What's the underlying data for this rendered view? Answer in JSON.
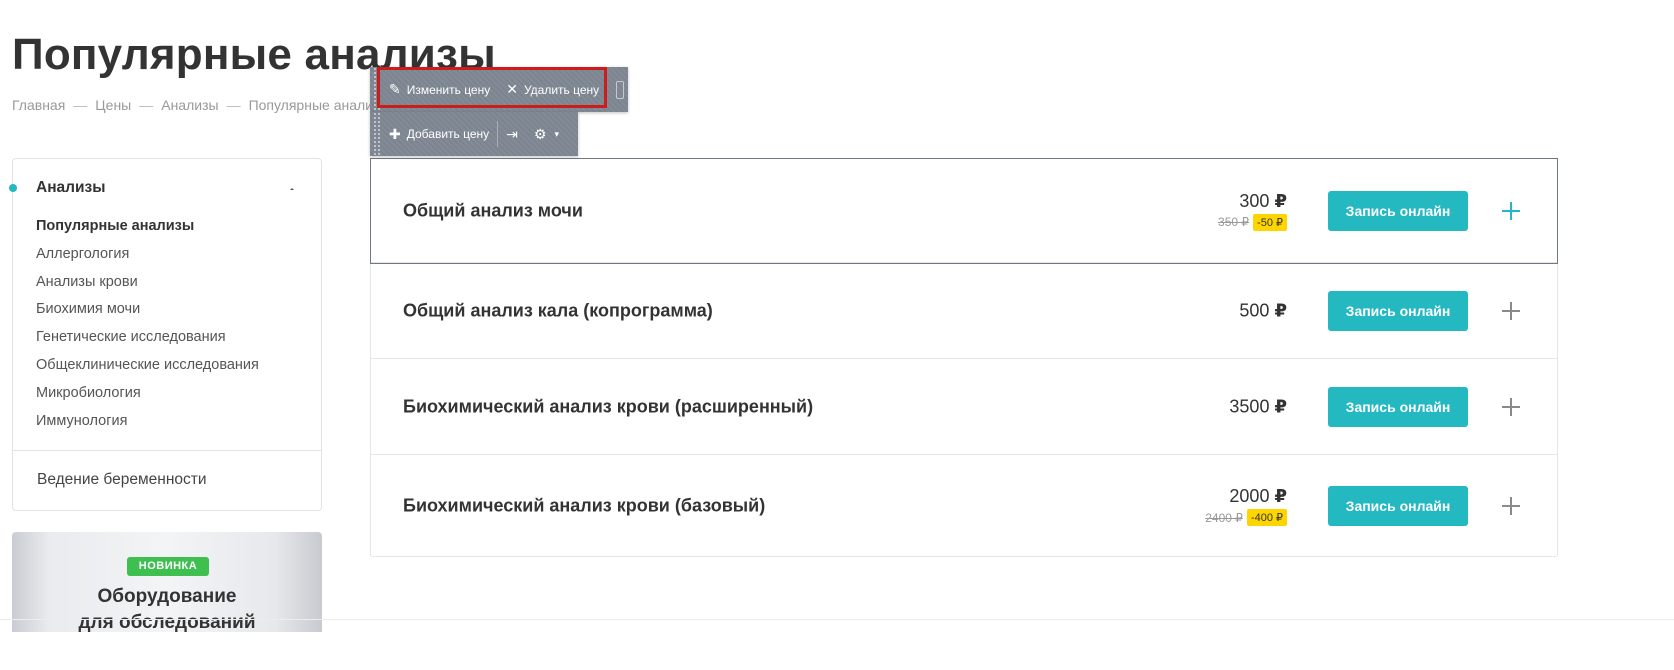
{
  "page": {
    "title": "Популярные анализы"
  },
  "breadcrumb": [
    "Главная",
    "Цены",
    "Анализы",
    "Популярные анализы"
  ],
  "sidebar": {
    "section_title": "Анализы",
    "items": [
      {
        "label": "Популярные анализы",
        "active": true
      },
      {
        "label": "Аллергология"
      },
      {
        "label": "Анализы крови"
      },
      {
        "label": "Биохимия мочи"
      },
      {
        "label": "Генетические исследования"
      },
      {
        "label": "Общеклинические исследования"
      },
      {
        "label": "Микробиология"
      },
      {
        "label": "Иммунология"
      }
    ],
    "extra_link": "Ведение беременности",
    "accent_color": "#24b8c0"
  },
  "promo": {
    "badge": "НОВИНКА",
    "title_line1": "Оборудование",
    "title_line2": "для обследований",
    "badge_color": "#3fbf4f"
  },
  "toolbar": {
    "edit_label": "Изменить цену",
    "delete_label": "Удалить цену",
    "add_label": "Добавить цену",
    "highlight_color": "#cc1d1d"
  },
  "prices": [
    {
      "name": "Общий анализ мочи",
      "price": "300",
      "currency": "₽",
      "old_price": "350 ₽",
      "discount": "-50 ₽",
      "button": "Запись онлайн"
    },
    {
      "name": "Общий анализ кала (копрограмма)",
      "price": "500",
      "currency": "₽",
      "button": "Запись онлайн"
    },
    {
      "name": "Биохимический анализ крови (расширенный)",
      "price": "3500",
      "currency": "₽",
      "button": "Запись онлайн"
    },
    {
      "name": "Биохимический анализ крови (базовый)",
      "price": "2000",
      "currency": "₽",
      "old_price": "2400 ₽",
      "discount": "-400 ₽",
      "button": "Запись онлайн"
    }
  ],
  "colors": {
    "button": "#24b8c0",
    "discount_badge": "#ffd500"
  }
}
